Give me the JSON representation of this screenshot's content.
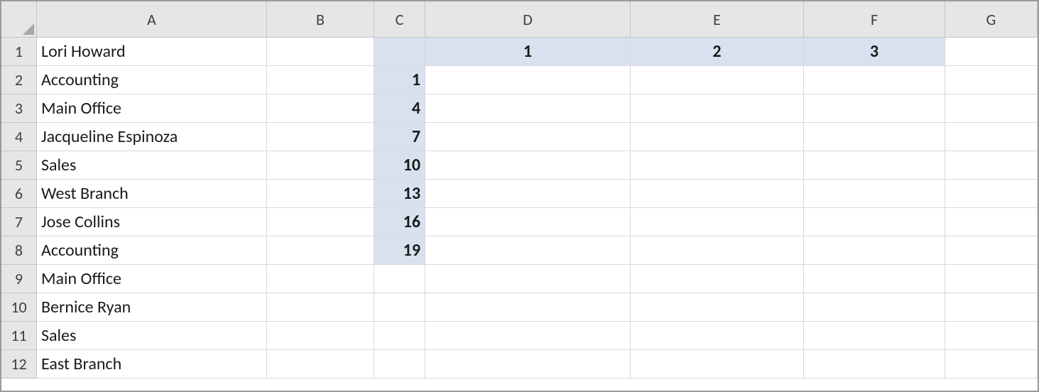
{
  "columns": [
    "A",
    "B",
    "C",
    "D",
    "E",
    "F",
    "G"
  ],
  "rowCount": 12,
  "colA": {
    "1": "Lori Howard",
    "2": "Accounting",
    "3": "Main Office",
    "4": "Jacqueline Espinoza",
    "5": "Sales",
    "6": "West Branch",
    "7": "Jose Collins",
    "8": "Accounting",
    "9": "Main Office",
    "10": "Bernice Ryan",
    "11": "Sales",
    "12": "East Branch"
  },
  "row1": {
    "D": "1",
    "E": "2",
    "F": "3"
  },
  "colC": {
    "2": "1",
    "3": "4",
    "4": "7",
    "5": "10",
    "6": "13",
    "7": "16",
    "8": "19"
  }
}
